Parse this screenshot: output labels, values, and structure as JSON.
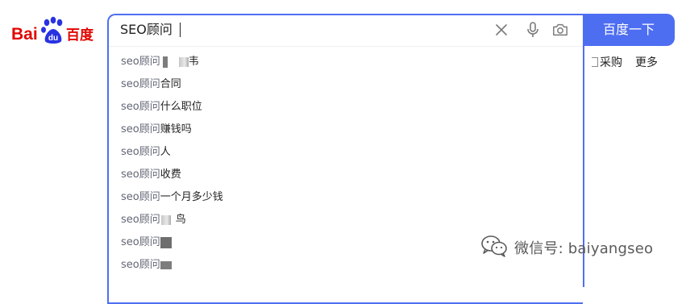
{
  "logo": {
    "text_left": "Bai",
    "text_paw": "du",
    "text_right": "百度"
  },
  "search": {
    "query": "SEO顾问"
  },
  "search_button": {
    "label": "百度一下"
  },
  "suggestions": [
    {
      "prefix": "seo顾问",
      "rest": "",
      "tail": "韦"
    },
    {
      "prefix": "seo顾问",
      "rest": "合同"
    },
    {
      "prefix": "seo顾问",
      "rest": "什么职位"
    },
    {
      "prefix": "seo顾问",
      "rest": "赚钱吗"
    },
    {
      "prefix": "seo顾问",
      "rest": "人"
    },
    {
      "prefix": "seo顾问",
      "rest": "收费"
    },
    {
      "prefix": "seo顾问",
      "rest": "一个月多少钱"
    },
    {
      "prefix": "seo顾问",
      "rest": "",
      "tail": "鸟"
    },
    {
      "prefix": "seo顾问",
      "rest": ""
    },
    {
      "prefix": "seo顾问",
      "rest": ""
    }
  ],
  "right_nav": {
    "caigou": "采购",
    "more": "更多"
  },
  "watermark": {
    "text": "微信号: baiyangseo"
  },
  "colors": {
    "brand_blue": "#4e6ef2",
    "baidu_red": "#e10601",
    "baidu_blue": "#2932e1"
  }
}
